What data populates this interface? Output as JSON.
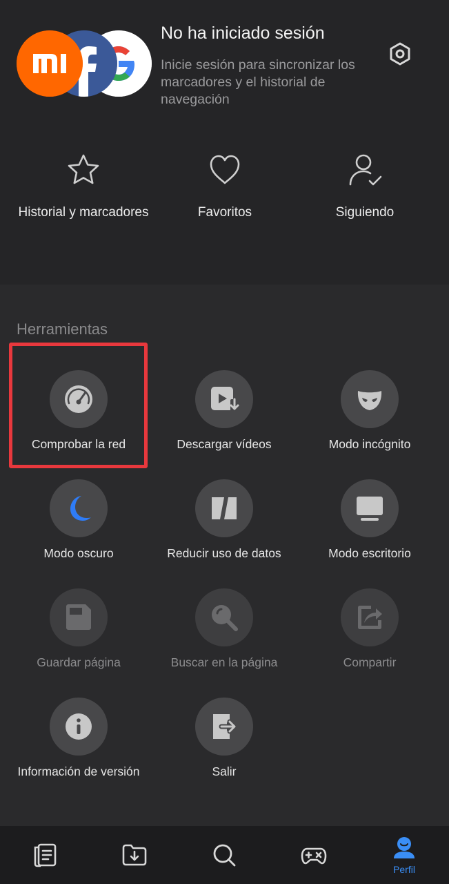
{
  "header": {
    "title": "No ha iniciado sesión",
    "subtitle": "Inicie sesión para sincronizar los marcadores y el historial de navegación",
    "settings_icon": "hexagon-settings-icon",
    "avatars": [
      "xiaomi-logo",
      "facebook-logo",
      "google-logo"
    ],
    "quick_links": [
      {
        "icon": "star-icon",
        "label": "Historial y marcadores"
      },
      {
        "icon": "heart-icon",
        "label": "Favoritos"
      },
      {
        "icon": "user-check-icon",
        "label": "Siguiendo"
      }
    ]
  },
  "tools": {
    "title": "Herramientas",
    "items": [
      {
        "icon": "speedometer-icon",
        "label": "Comprobar la red",
        "enabled": true
      },
      {
        "icon": "video-download-icon",
        "label": "Descargar vídeos",
        "enabled": true
      },
      {
        "icon": "incognito-mask-icon",
        "label": "Modo incógnito",
        "enabled": true
      },
      {
        "icon": "moon-icon",
        "label": "Modo oscuro",
        "enabled": true
      },
      {
        "icon": "data-saver-icon",
        "label": "Reducir uso de datos",
        "enabled": true
      },
      {
        "icon": "desktop-icon",
        "label": "Modo escritorio",
        "enabled": true
      },
      {
        "icon": "save-icon",
        "label": "Guardar página",
        "enabled": false
      },
      {
        "icon": "search-page-icon",
        "label": "Buscar en la página",
        "enabled": false
      },
      {
        "icon": "share-icon",
        "label": "Compartir",
        "enabled": false
      },
      {
        "icon": "info-icon",
        "label": "Información de versión",
        "enabled": true
      },
      {
        "icon": "exit-icon",
        "label": "Salir",
        "enabled": true
      }
    ]
  },
  "colors": {
    "background": "#2a2a2c",
    "header_bg": "#252527",
    "accent": "#3a8ef6",
    "highlight": "#e8383d",
    "moon": "#2f7cf6"
  },
  "bottom_nav": {
    "items": [
      {
        "icon": "news-feed-icon"
      },
      {
        "icon": "downloads-folder-icon"
      },
      {
        "icon": "search-icon"
      },
      {
        "icon": "games-controller-icon"
      },
      {
        "icon": "profile-icon",
        "label": "Perfil",
        "active": true
      }
    ]
  }
}
